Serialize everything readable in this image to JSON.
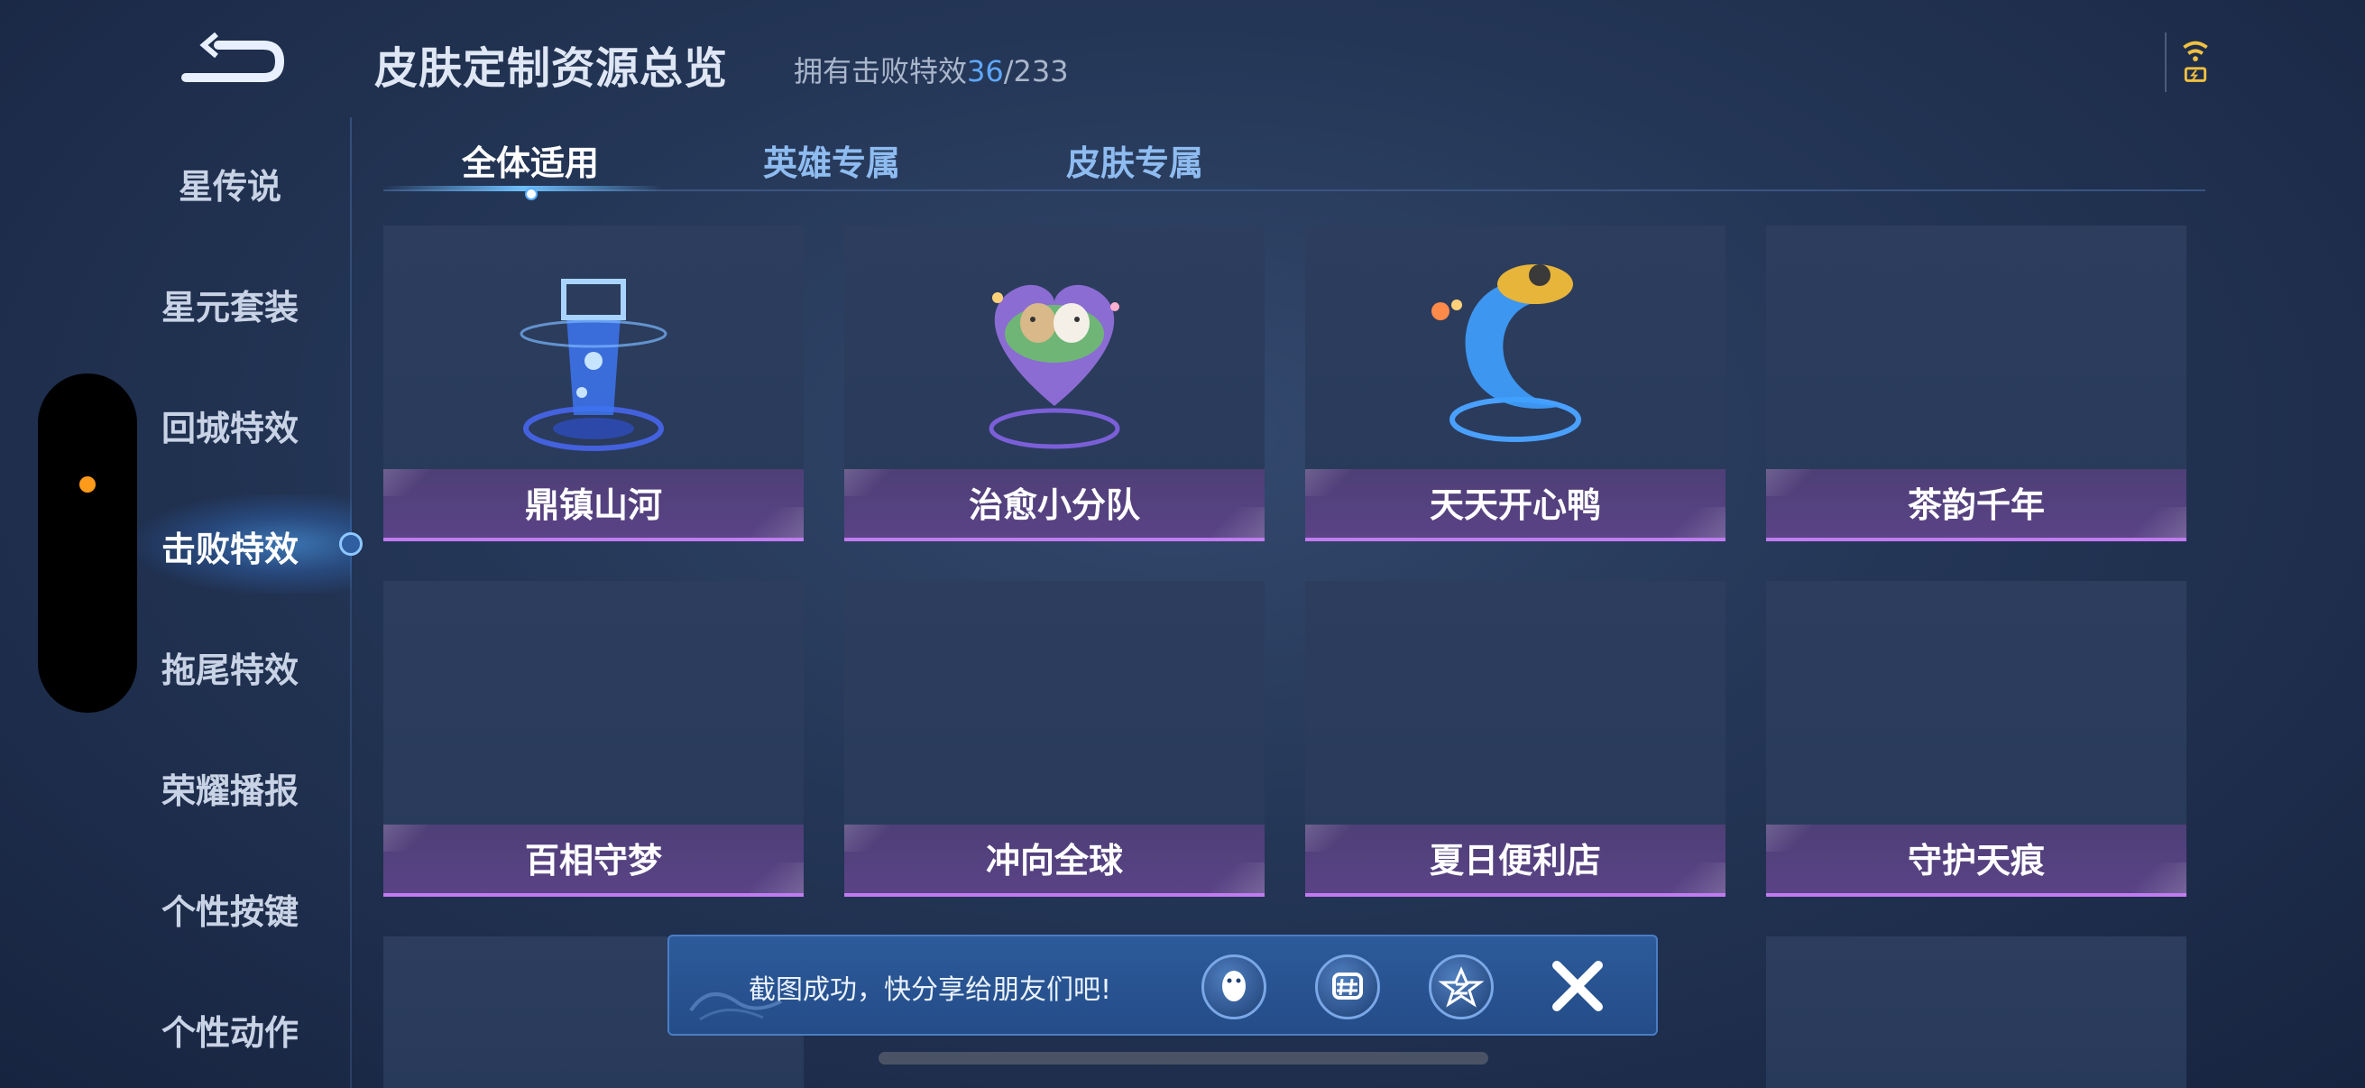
{
  "header": {
    "title": "皮肤定制资源总览",
    "owned_prefix": "拥有击败特效",
    "owned_count": "36",
    "owned_total": "/233"
  },
  "nav": {
    "items": [
      {
        "label": "星传说"
      },
      {
        "label": "星元套装"
      },
      {
        "label": "回城特效"
      },
      {
        "label": "击败特效"
      },
      {
        "label": "拖尾特效"
      },
      {
        "label": "荣耀播报"
      },
      {
        "label": "个性按键"
      },
      {
        "label": "个性动作"
      }
    ],
    "active_index": 3
  },
  "tabs": [
    {
      "label": "全体适用"
    },
    {
      "label": "英雄专属"
    },
    {
      "label": "皮肤专属"
    }
  ],
  "cards": [
    {
      "label": "鼎镇山河",
      "icon": "cauldron-tower-icon"
    },
    {
      "label": "治愈小分队",
      "icon": "healing-squad-icon"
    },
    {
      "label": "天天开心鸭",
      "icon": "happy-duck-icon"
    },
    {
      "label": "茶韵千年",
      "icon": ""
    },
    {
      "label": "百相守梦",
      "icon": ""
    },
    {
      "label": "冲向全球",
      "icon": ""
    },
    {
      "label": "夏日便利店",
      "icon": ""
    },
    {
      "label": "守护天痕",
      "icon": ""
    }
  ],
  "toast": {
    "text": "截图成功，快分享给朋友们吧!",
    "buttons": [
      "qq-share-icon",
      "wechat-moments-share-icon",
      "qzone-share-icon"
    ]
  },
  "colors": {
    "accent": "#5fa8ff",
    "card_label_bg": "#5a4386",
    "card_label_border": "#c07cf0",
    "notification_dot": "#ff9a1a"
  }
}
